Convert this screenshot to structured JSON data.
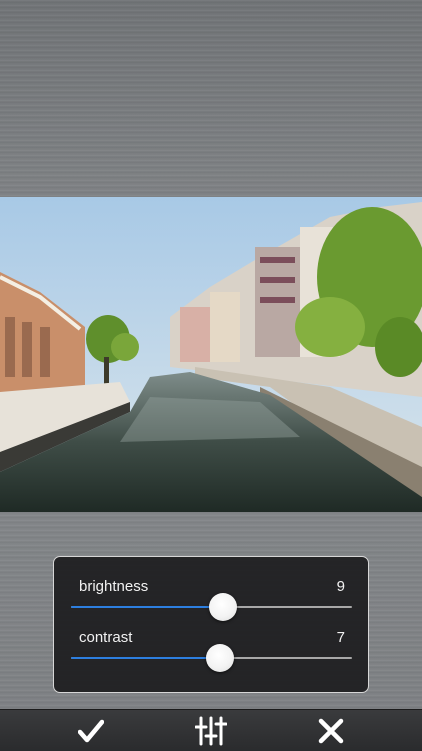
{
  "colors": {
    "accent": "#2d7fe0",
    "panel_bg": "#1c1c1e",
    "toolbar_bg": "#2e2f31"
  },
  "adjustments": {
    "brightness": {
      "label": "brightness",
      "value": "9",
      "level": 0.54
    },
    "contrast": {
      "label": "contrast",
      "value": "7",
      "level": 0.53
    }
  },
  "toolbar": {
    "buttons": [
      {
        "icon": "checkmark-icon",
        "action": "apply"
      },
      {
        "icon": "sliders-icon",
        "action": "adjust"
      },
      {
        "icon": "close-icon",
        "action": "cancel"
      }
    ]
  }
}
